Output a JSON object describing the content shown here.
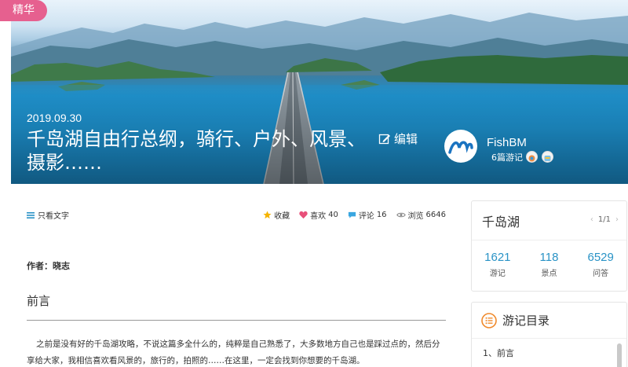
{
  "hero": {
    "badge": "精华",
    "date": "2019.09.30",
    "title": "千岛湖自由行总纲，骑行、户外、风景、摄影……",
    "edit_label": "编辑"
  },
  "author": {
    "name": "FishBM",
    "count": "6篇游记"
  },
  "toolbar": {
    "text_only": "只看文字",
    "favorite": "收藏",
    "like": "喜欢",
    "like_count": "40",
    "comment": "评论",
    "comment_count": "16",
    "views": "浏览",
    "views_count": "6646"
  },
  "article": {
    "author_line": "作者：晓志",
    "section_title": "前言",
    "paragraph": "之前是没有好的千岛湖攻略，不说这篇多全什么的，纯粹是自己熟悉了，大多数地方自己也是踩过点的，然后分享给大家，我相信喜欢看风景的，旅行的，拍照的……在这里，一定会找到你想要的千岛湖。"
  },
  "destination": {
    "name": "千岛湖",
    "page": "1/1",
    "stats": [
      {
        "value": "1621",
        "label": "游记"
      },
      {
        "value": "118",
        "label": "景点"
      },
      {
        "value": "6529",
        "label": "问答"
      }
    ]
  },
  "toc": {
    "title": "游记目录",
    "items": [
      "1、前言"
    ]
  },
  "colors": {
    "badge": "#e6608f",
    "accent_blue": "#2a93c6",
    "toc_icon": "#f08a2c",
    "like": "#e8507a",
    "star": "#f5b400"
  }
}
